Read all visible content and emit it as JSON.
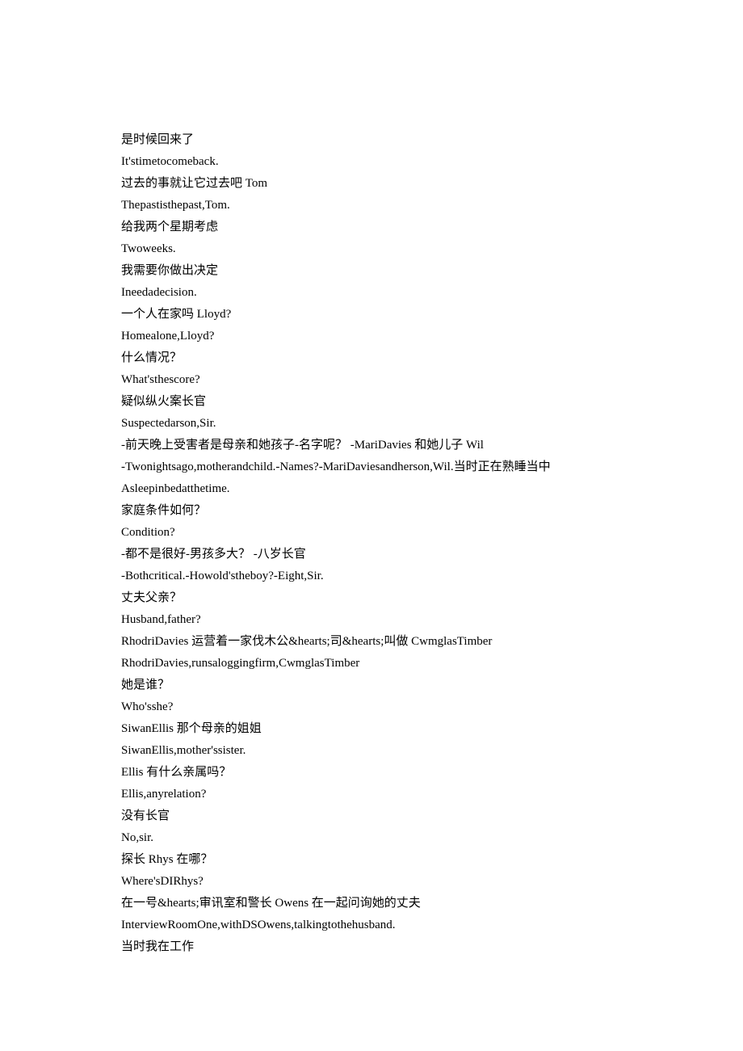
{
  "lines": [
    "是时候回来了",
    "It'stimetocomeback.",
    "过去的事就让它过去吧 Tom",
    "Thepastisthepast,Tom.",
    "给我两个星期考虑",
    "Twoweeks.",
    "我需要你做出决定",
    "Ineedadecision.",
    "一个人在家吗 Lloyd?",
    "Homealone,Lloyd?",
    "什么情况？",
    "What'sthescore?",
    "疑似纵火案长官",
    "Suspectedarson,Sir.",
    "-前天晚上受害者是母亲和她孩子-名字呢？ -MariDavies 和她儿子 Wil",
    "-Twonightsago,motherandchild.-Names?-MariDaviesandherson,Wil.当时正在熟睡当中",
    "Asleepinbedatthetime.",
    "家庭条件如何？",
    "Condition?",
    "-都不是很好-男孩多大？ -八岁长官",
    "-Bothcritical.-Howold'stheboy?-Eight,Sir.",
    "丈夫父亲？",
    "Husband,father?",
    "RhodriDavies 运营着一家伐木公&hearts;司&hearts;叫做 CwmglasTimber",
    "RhodriDavies,runsaloggingfirm,CwmglasTimber",
    "她是谁？",
    "Who'sshe?",
    "SiwanEllis 那个母亲的姐姐",
    "SiwanEllis,mother'ssister.",
    "Ellis 有什么亲属吗？",
    "Ellis,anyrelation?",
    "没有长官",
    "No,sir.",
    "探长 Rhys 在哪？",
    "Where'sDIRhys?",
    "在一号&hearts;审讯室和警长 Owens 在一起问询她的丈夫",
    "InterviewRoomOne,withDSOwens,talkingtothehusband.",
    "当时我在工作"
  ]
}
